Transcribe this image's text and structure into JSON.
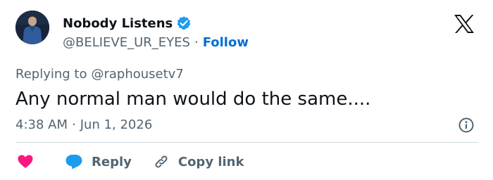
{
  "author": {
    "display_name": "Nobody Listens",
    "handle": "@BELIEVE_UR_EYES",
    "separator": "·",
    "follow_label": "Follow",
    "verified": true,
    "avatar_icon": "profile-photo"
  },
  "brand": {
    "logo_icon": "x-logo-icon"
  },
  "reply_context": {
    "prefix": "Replying to",
    "handle": "@raphousetv7"
  },
  "tweet": {
    "text": "Any normal man would do the same....",
    "time": "4:38 AM",
    "separator": "·",
    "date": "Jun 1, 2026"
  },
  "actions": {
    "like_icon": "heart-icon",
    "reply_icon": "speech-bubble-icon",
    "reply_label": "Reply",
    "copy_icon": "link-icon",
    "copy_label": "Copy link",
    "info_icon": "info-icon"
  },
  "colors": {
    "text_primary": "#0f1419",
    "text_secondary": "#536471",
    "link_blue": "#006fd6",
    "verified_blue": "#1d9bf0",
    "like_red": "#f91880",
    "divider": "#cfd9de"
  }
}
